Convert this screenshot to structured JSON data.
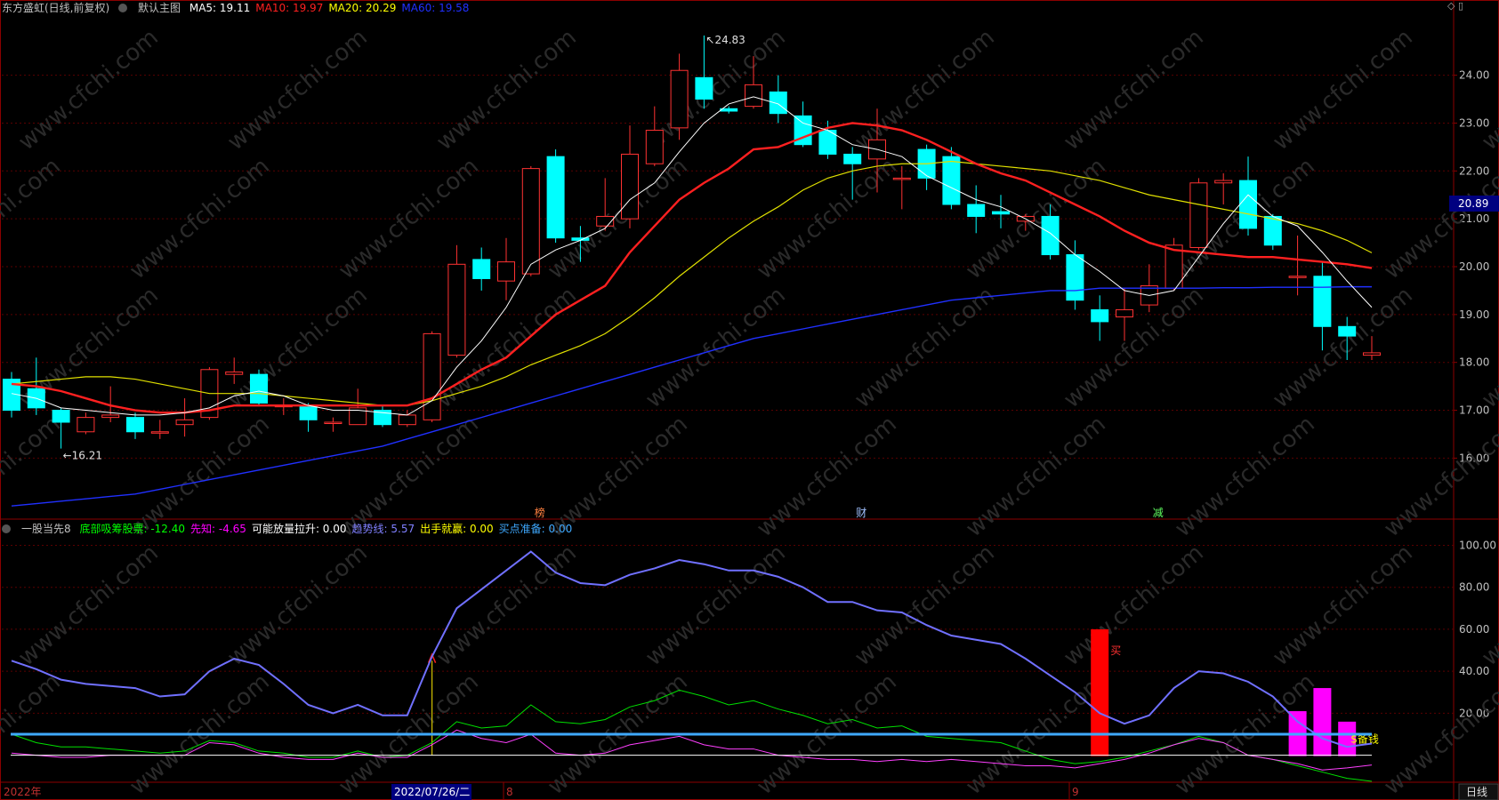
{
  "title": "东方盛虹(日线,前复权)",
  "main_chart_label": "默认主图",
  "ma_legend": [
    {
      "label": "MA5: 19.11",
      "color": "#ffffff"
    },
    {
      "label": "MA10: 19.97",
      "color": "#ff2020"
    },
    {
      "label": "MA20: 20.29",
      "color": "#ffff00"
    },
    {
      "label": "MA60: 19.58",
      "color": "#2030ff"
    }
  ],
  "indicator_name": "一股当先8",
  "indicator_legend": [
    {
      "label": "底部吸筹股票: -12.40",
      "color": "#00ff00"
    },
    {
      "label": "先知: -4.65",
      "color": "#ff00ff"
    },
    {
      "label": "可能放量拉升: 0.00",
      "color": "#ffffff"
    },
    {
      "label": "趋势线: 5.57",
      "color": "#8080ff"
    },
    {
      "label": "出手就赢: 0.00",
      "color": "#ffff00"
    },
    {
      "label": "买点准备: 0.00",
      "color": "#3fa9ff"
    }
  ],
  "last_price_tag": "20.89",
  "period_label": "日线",
  "cursor_date": "2022/07/26/二",
  "year_label": "2022年",
  "month_labels": [
    "8",
    "9"
  ],
  "event_markers": [
    "榜",
    "财",
    "减"
  ],
  "signal_labels": {
    "buy": "买",
    "ready": "$备钱"
  },
  "high_label": "24.83",
  "low_label": "16.21",
  "watermark": "www.cfchi.com",
  "colors": {
    "up": "#ff3232",
    "down": "#00ffff",
    "axis": "#8b0000",
    "grid": "#5a0000"
  },
  "chart_data": [
    {
      "type": "candlestick",
      "price_ticks": [
        24,
        23,
        22,
        21,
        20,
        19,
        18,
        17,
        16
      ],
      "ylim": [
        14.8,
        25.2
      ],
      "candles": [
        [
          17.65,
          17.0,
          17.8,
          16.85
        ],
        [
          17.45,
          17.05,
          18.1,
          16.9
        ],
        [
          17.0,
          16.75,
          17.05,
          16.2
        ],
        [
          16.55,
          16.85,
          16.95,
          16.5
        ],
        [
          16.85,
          16.9,
          17.5,
          16.75
        ],
        [
          16.85,
          16.55,
          16.95,
          16.4
        ],
        [
          16.55,
          16.55,
          16.8,
          16.4
        ],
        [
          16.7,
          16.8,
          17.25,
          16.45
        ],
        [
          16.85,
          17.85,
          17.9,
          16.8
        ],
        [
          17.75,
          17.8,
          18.1,
          17.55
        ],
        [
          17.75,
          17.15,
          17.85,
          17.1
        ],
        [
          17.1,
          17.1,
          17.25,
          16.9
        ],
        [
          17.1,
          16.8,
          17.15,
          16.55
        ],
        [
          16.75,
          16.75,
          16.85,
          16.55
        ],
        [
          16.7,
          17.05,
          17.45,
          16.7
        ],
        [
          17.0,
          16.7,
          17.1,
          16.65
        ],
        [
          16.7,
          16.9,
          17.0,
          16.65
        ],
        [
          16.8,
          18.6,
          18.65,
          16.75
        ],
        [
          18.15,
          20.05,
          20.45,
          18.1
        ],
        [
          20.15,
          19.75,
          20.4,
          19.5
        ],
        [
          19.7,
          20.1,
          20.6,
          19.3
        ],
        [
          19.85,
          22.05,
          22.1,
          19.8
        ],
        [
          22.3,
          20.6,
          22.45,
          20.5
        ],
        [
          20.6,
          20.55,
          20.85,
          20.1
        ],
        [
          20.85,
          21.05,
          21.85,
          20.75
        ],
        [
          21.0,
          22.35,
          22.95,
          20.8
        ],
        [
          22.15,
          22.85,
          23.35,
          22.1
        ],
        [
          22.9,
          24.1,
          24.45,
          22.65
        ],
        [
          23.95,
          23.5,
          24.83,
          23.3
        ],
        [
          23.3,
          23.25,
          23.35,
          23.2
        ],
        [
          23.35,
          23.8,
          24.4,
          23.3
        ],
        [
          23.65,
          23.2,
          24.0,
          23.0
        ],
        [
          23.15,
          22.55,
          23.45,
          22.5
        ],
        [
          22.85,
          22.35,
          23.05,
          22.25
        ],
        [
          22.35,
          22.15,
          22.5,
          21.4
        ],
        [
          22.25,
          22.65,
          23.3,
          21.55
        ],
        [
          21.85,
          21.85,
          22.1,
          21.2
        ],
        [
          22.45,
          21.85,
          22.55,
          21.6
        ],
        [
          22.3,
          21.3,
          22.5,
          21.2
        ],
        [
          21.3,
          21.05,
          21.7,
          20.7
        ],
        [
          21.15,
          21.1,
          21.5,
          20.8
        ],
        [
          20.95,
          21.05,
          21.1,
          20.75
        ],
        [
          21.05,
          20.25,
          21.3,
          20.15
        ],
        [
          20.25,
          19.3,
          20.55,
          19.1
        ],
        [
          19.1,
          18.85,
          19.4,
          18.45
        ],
        [
          18.95,
          19.1,
          19.55,
          18.45
        ],
        [
          19.2,
          19.6,
          20.05,
          19.05
        ],
        [
          19.55,
          20.45,
          20.6,
          19.5
        ],
        [
          20.4,
          21.75,
          21.85,
          20.35
        ],
        [
          21.75,
          21.8,
          21.95,
          21.3
        ],
        [
          21.8,
          20.8,
          22.3,
          20.65
        ],
        [
          21.05,
          20.45,
          21.1,
          20.35
        ],
        [
          19.8,
          19.8,
          20.65,
          19.4
        ],
        [
          19.8,
          18.75,
          20.1,
          18.25
        ],
        [
          18.75,
          18.55,
          18.95,
          18.05
        ],
        [
          18.15,
          18.2,
          18.55,
          18.05
        ]
      ],
      "ma5": [
        17.35,
        17.25,
        17.05,
        17.0,
        16.95,
        16.9,
        16.9,
        16.95,
        17.05,
        17.3,
        17.4,
        17.3,
        17.1,
        17.0,
        17.0,
        16.95,
        16.9,
        17.2,
        17.9,
        18.45,
        19.15,
        20.05,
        20.35,
        20.55,
        20.8,
        21.4,
        21.75,
        22.4,
        23.0,
        23.4,
        23.55,
        23.4,
        23.0,
        22.85,
        22.55,
        22.45,
        22.3,
        21.9,
        21.65,
        21.4,
        21.25,
        21.0,
        20.7,
        20.25,
        19.9,
        19.5,
        19.4,
        19.5,
        20.2,
        20.9,
        21.5,
        21.05,
        20.85,
        20.3,
        19.7,
        19.15
      ],
      "ma10": [
        17.55,
        17.5,
        17.4,
        17.25,
        17.1,
        17.0,
        16.95,
        16.95,
        17.0,
        17.1,
        17.1,
        17.1,
        17.1,
        17.1,
        17.1,
        17.1,
        17.1,
        17.25,
        17.55,
        17.85,
        18.1,
        18.55,
        19.0,
        19.3,
        19.6,
        20.3,
        20.85,
        21.4,
        21.75,
        22.05,
        22.45,
        22.5,
        22.7,
        22.9,
        23.0,
        22.95,
        22.85,
        22.65,
        22.4,
        22.15,
        21.95,
        21.8,
        21.55,
        21.3,
        21.05,
        20.75,
        20.5,
        20.35,
        20.3,
        20.25,
        20.2,
        20.2,
        20.15,
        20.1,
        20.05,
        19.97
      ],
      "ma20": [
        17.55,
        17.6,
        17.65,
        17.7,
        17.7,
        17.65,
        17.55,
        17.45,
        17.35,
        17.35,
        17.35,
        17.3,
        17.25,
        17.2,
        17.15,
        17.1,
        17.1,
        17.2,
        17.35,
        17.5,
        17.7,
        17.95,
        18.15,
        18.35,
        18.6,
        18.95,
        19.35,
        19.8,
        20.2,
        20.6,
        20.95,
        21.25,
        21.6,
        21.85,
        22.0,
        22.1,
        22.15,
        22.15,
        22.2,
        22.15,
        22.1,
        22.05,
        22.0,
        21.9,
        21.8,
        21.65,
        21.5,
        21.4,
        21.3,
        21.2,
        21.1,
        21.0,
        20.9,
        20.75,
        20.55,
        20.29
      ],
      "ma60": [
        15.0,
        15.05,
        15.1,
        15.15,
        15.2,
        15.25,
        15.35,
        15.45,
        15.55,
        15.65,
        15.75,
        15.85,
        15.95,
        16.05,
        16.15,
        16.25,
        16.4,
        16.55,
        16.7,
        16.85,
        17.0,
        17.15,
        17.3,
        17.45,
        17.6,
        17.75,
        17.9,
        18.05,
        18.2,
        18.35,
        18.5,
        18.6,
        18.7,
        18.8,
        18.9,
        19.0,
        19.1,
        19.2,
        19.3,
        19.35,
        19.4,
        19.45,
        19.5,
        19.5,
        19.55,
        19.55,
        19.55,
        19.55,
        19.55,
        19.56,
        19.56,
        19.57,
        19.57,
        19.57,
        19.58,
        19.58
      ]
    },
    {
      "type": "line",
      "y_ticks": [
        100,
        80,
        60,
        40,
        20
      ],
      "ylim": [
        -12,
        104
      ],
      "series": [
        {
          "name": "趋势线",
          "values": [
            45,
            41,
            36,
            34,
            33,
            32,
            28,
            29,
            40,
            46,
            43,
            34,
            24,
            20,
            24,
            19,
            19,
            47,
            70,
            79,
            88,
            97,
            87,
            82,
            81,
            86,
            89,
            93,
            91,
            88,
            88,
            85,
            80,
            73,
            73,
            69,
            68,
            62,
            57,
            55,
            53,
            46,
            38,
            30,
            20,
            15,
            19,
            32,
            40,
            39,
            35,
            28,
            16,
            8,
            4,
            5.57
          ]
        },
        {
          "name": "底部吸筹股票",
          "values": [
            10,
            6,
            4,
            4,
            3,
            2,
            1,
            2,
            7,
            6,
            2,
            1,
            -1,
            -1,
            2,
            -1,
            0,
            6,
            16,
            13,
            14,
            24,
            16,
            15,
            17,
            23,
            26,
            31,
            28,
            24,
            26,
            22,
            19,
            15,
            17,
            13,
            14,
            9,
            8,
            7,
            6,
            2,
            -2,
            -4,
            -3,
            -1,
            2,
            5,
            9,
            6,
            0,
            -2,
            -5,
            -8,
            -11,
            -12.4
          ]
        },
        {
          "name": "先知",
          "values": [
            1,
            0,
            -1,
            -1,
            0,
            0,
            0,
            0,
            6,
            5,
            1,
            -1,
            -2,
            -2,
            1,
            -1,
            -1,
            5,
            12,
            8,
            6,
            10,
            1,
            0,
            1,
            5,
            7,
            9,
            5,
            3,
            3,
            0,
            -1,
            -2,
            -2,
            -3,
            -2,
            -3,
            -2,
            -3,
            -4,
            -5,
            -5,
            -6,
            -4,
            -2,
            1,
            5,
            8,
            6,
            0,
            -2,
            -4,
            -7,
            -6,
            -4.65
          ]
        },
        {
          "name": "买点准备",
          "values": [
            10
          ]
        },
        {
          "name": "可能放量拉升",
          "values": [
            0
          ]
        }
      ],
      "bars": [
        {
          "index": 44,
          "value": 60,
          "color": "#ff0000"
        },
        {
          "index": 52,
          "value": 21,
          "color": "#ff00ff"
        },
        {
          "index": 53,
          "value": 32,
          "color": "#ff00ff"
        },
        {
          "index": 54,
          "value": 16,
          "color": "#ff00ff"
        }
      ],
      "yellow_signal_index": 17
    }
  ]
}
